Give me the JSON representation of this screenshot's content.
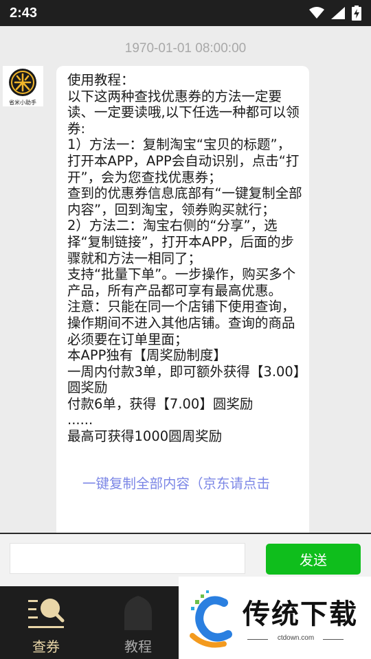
{
  "status_bar": {
    "time": "2:43",
    "icons": [
      "wifi-icon",
      "signal-icon",
      "battery-charging-icon"
    ]
  },
  "chat": {
    "timestamp": "1970-01-01 08:00:00",
    "avatar_caption": "省米小助手",
    "message_lines": [
      "使用教程：",
      "以下这两种查找优惠券的方法一定要读、一定要读哦,以下任选一种都可以领券:",
      "1）方法一：复制淘宝“宝贝的标题”，打开本APP，APP会自动识别，点击“打开”，会为您查找优惠券；",
      "查到的优惠券信息底部有“一键复制全部内容”，回到淘宝，领券购买就行；",
      "2）方法二：淘宝右侧的“分享”，选择“复制链接”，打开本APP，后面的步骤就和方法一相同了；",
      "支持“批量下单”。一步操作，购买多个产品，所有产品都可享有最高优惠。",
      "注意：只能在同一个店铺下使用查询，操作期间不进入其他店铺。查询的商品必须要在订单里面；",
      "本APP独有【周奖励制度】",
      "一周内付款3单，即可额外获得【3.00】圆奖励",
      "付款6单，获得【7.00】圆奖励",
      "......",
      "最高可获得1000圆周奖励"
    ],
    "copy_link": "一键复制全部内容（京东请点击"
  },
  "input": {
    "value": "",
    "placeholder": "",
    "send_label": "发送"
  },
  "nav": {
    "items": [
      {
        "label": "查券",
        "icon": "search-coupon-icon",
        "active": true
      },
      {
        "label": "教程",
        "icon": "house-icon",
        "active": false
      }
    ]
  },
  "watermark": {
    "text": "传统下载",
    "url": "ctdown.com"
  },
  "colors": {
    "status_bar": "#1f1f1f",
    "send_button": "#0fbe1c",
    "link": "#7b86e6",
    "nav_active": "#e9d6a8",
    "nav_bg": "#1d1d1d"
  }
}
